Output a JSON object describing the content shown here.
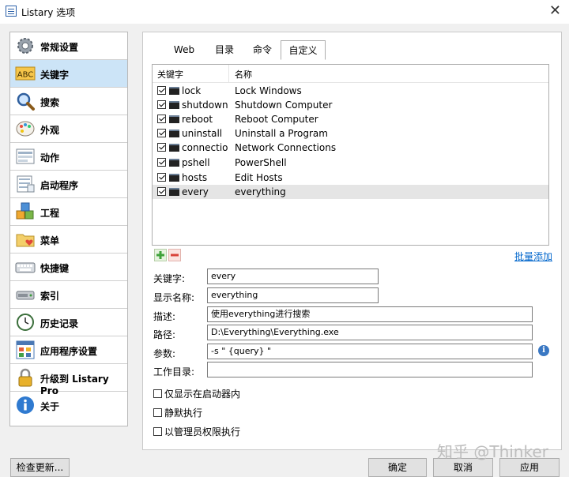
{
  "window": {
    "title": "Listary 选项"
  },
  "sidebar": {
    "items": [
      {
        "label": "常规设置",
        "icon": "gear-icon"
      },
      {
        "label": "关键字",
        "icon": "abc-icon"
      },
      {
        "label": "搜索",
        "icon": "magnifier-icon"
      },
      {
        "label": "外观",
        "icon": "palette-icon"
      },
      {
        "label": "动作",
        "icon": "action-icon"
      },
      {
        "label": "启动程序",
        "icon": "launcher-icon"
      },
      {
        "label": "工程",
        "icon": "cubes-icon"
      },
      {
        "label": "菜单",
        "icon": "folder-heart-icon"
      },
      {
        "label": "快捷键",
        "icon": "keyboard-icon"
      },
      {
        "label": "索引",
        "icon": "disk-icon"
      },
      {
        "label": "历史记录",
        "icon": "clock-icon"
      },
      {
        "label": "应用程序设置",
        "icon": "app-grid-icon"
      },
      {
        "label": "升级到 Listary Pro",
        "icon": "lock-icon"
      },
      {
        "label": "关于",
        "icon": "info-icon"
      }
    ],
    "selected_index": 1
  },
  "tabs": [
    {
      "label": "Web"
    },
    {
      "label": "目录"
    },
    {
      "label": "命令"
    },
    {
      "label": "自定义"
    }
  ],
  "table": {
    "headers": [
      "关键字",
      "名称"
    ],
    "rows": [
      {
        "keyword": "lock",
        "name": "Lock Windows"
      },
      {
        "keyword": "shutdown",
        "name": "Shutdown Computer"
      },
      {
        "keyword": "reboot",
        "name": "Reboot Computer"
      },
      {
        "keyword": "uninstall",
        "name": "Uninstall a Program"
      },
      {
        "keyword": "connectio...",
        "name": "Network Connections"
      },
      {
        "keyword": "pshell",
        "name": "PowerShell"
      },
      {
        "keyword": "hosts",
        "name": "Edit Hosts"
      },
      {
        "keyword": "every",
        "name": "everything"
      }
    ]
  },
  "batch_add_link": "批量添加",
  "form": {
    "keyword_label": "关键字:",
    "keyword_value": "every",
    "display_label": "显示名称:",
    "display_value": "everything",
    "desc_label": "描述:",
    "desc_value": "使用everything进行搜索",
    "path_label": "路径:",
    "path_value": "D:\\Everything\\Everything.exe",
    "args_label": "参数:",
    "args_value": "-s \" {query} \"",
    "workdir_label": "工作目录:",
    "workdir_value": ""
  },
  "options": {
    "launcher_only": "仅显示在启动器内",
    "silent": "静默执行",
    "admin": "以管理员权限执行"
  },
  "buttons": {
    "check_update": "检查更新...",
    "ok": "确定",
    "cancel": "取消",
    "apply": "应用"
  },
  "watermark": "知乎 @Thinker",
  "colors": {
    "selection": "#cce4f7",
    "link": "#0066cc",
    "row_highlight": "#e5e5e5"
  }
}
